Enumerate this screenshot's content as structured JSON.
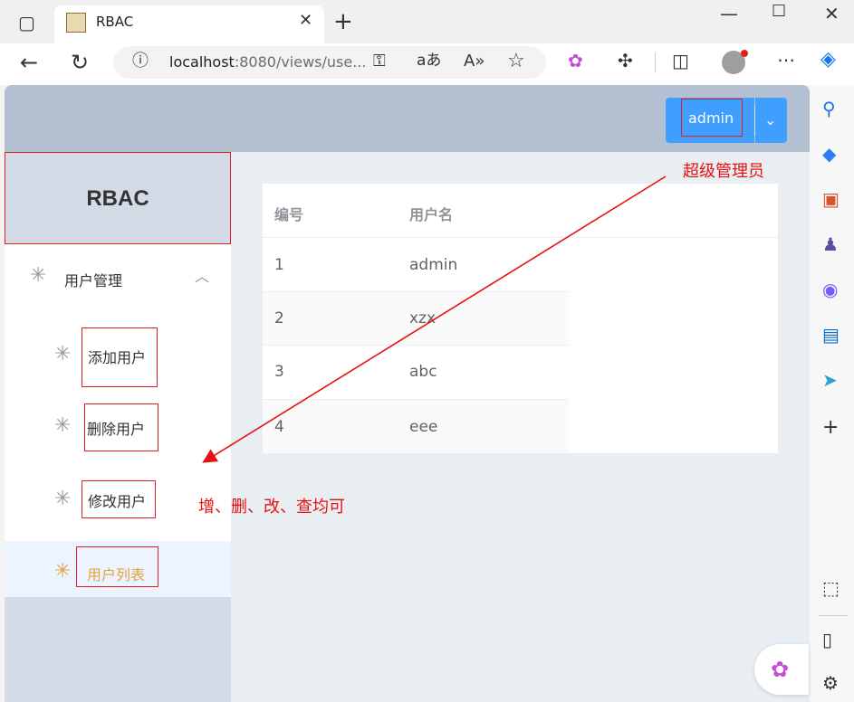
{
  "browser": {
    "tab_title": "RBAC",
    "url_host": "localhost",
    "url_rest": ":8080/views/use...",
    "new_tab": "+"
  },
  "header": {
    "user_label": "admin",
    "dropdown_icon": "chevron-down-icon"
  },
  "sidebar": {
    "logo": "RBAC",
    "group_label": "用户管理",
    "items": [
      {
        "label": "添加用户"
      },
      {
        "label": "删除用户"
      },
      {
        "label": "修改用户"
      },
      {
        "label": "用户列表"
      }
    ]
  },
  "table": {
    "columns": [
      "编号",
      "用户名"
    ],
    "rows": [
      [
        "1",
        "admin"
      ],
      [
        "2",
        "xzx"
      ],
      [
        "3",
        "abc"
      ],
      [
        "4",
        "eee"
      ]
    ]
  },
  "annotations": {
    "role_note": "超级管理员",
    "crud_note": "增、删、改、查均可"
  },
  "colors": {
    "accent": "#409eff",
    "annotation": "#e81010",
    "active_item": "#e6a23c"
  }
}
